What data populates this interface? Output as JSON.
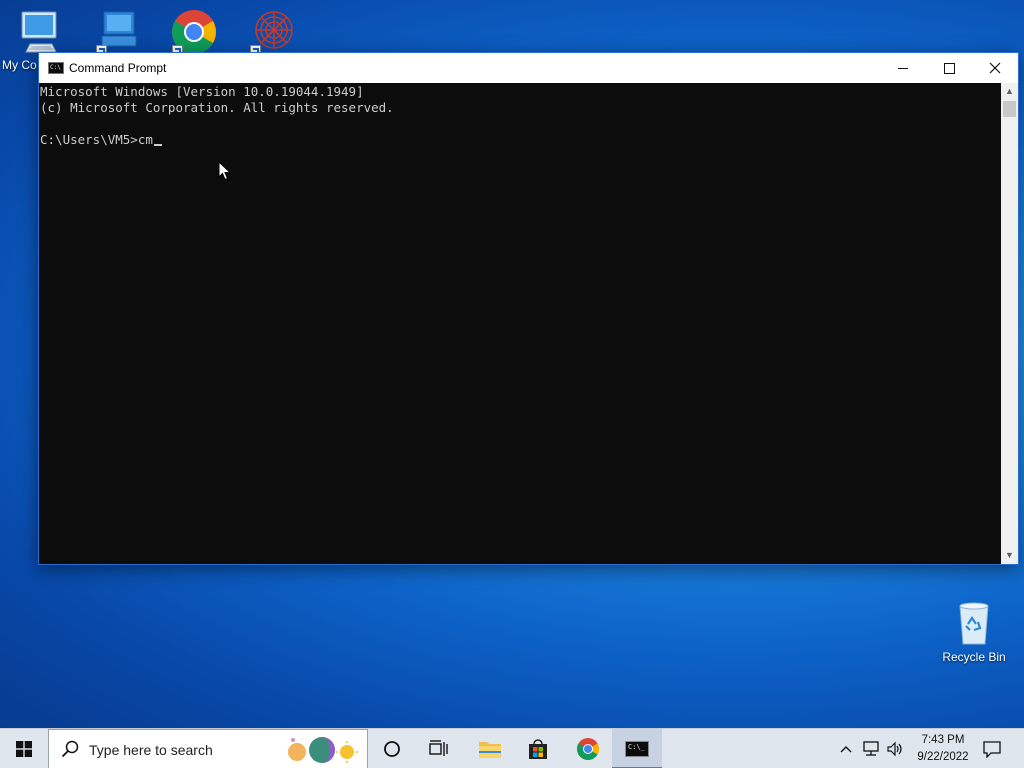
{
  "desktop": {
    "icons": [
      {
        "label": "My Co"
      },
      {
        "label": ""
      },
      {
        "label": ""
      },
      {
        "label": ""
      },
      {
        "label": "Recycle Bin"
      }
    ]
  },
  "window": {
    "title": "Command Prompt",
    "console_lines": [
      "Microsoft Windows [Version 10.0.19044.1949]",
      "(c) Microsoft Corporation. All rights reserved.",
      "",
      "C:\\Users\\VM5>cm"
    ]
  },
  "taskbar": {
    "search_placeholder": "Type here to search",
    "clock_time": "7:43 PM",
    "clock_date": "9/22/2022"
  },
  "colors": {
    "console_bg": "#0c0c0c",
    "console_text": "#cccccc",
    "taskbar_bg": "#dfe6ee",
    "accent": "#3a84d8"
  }
}
